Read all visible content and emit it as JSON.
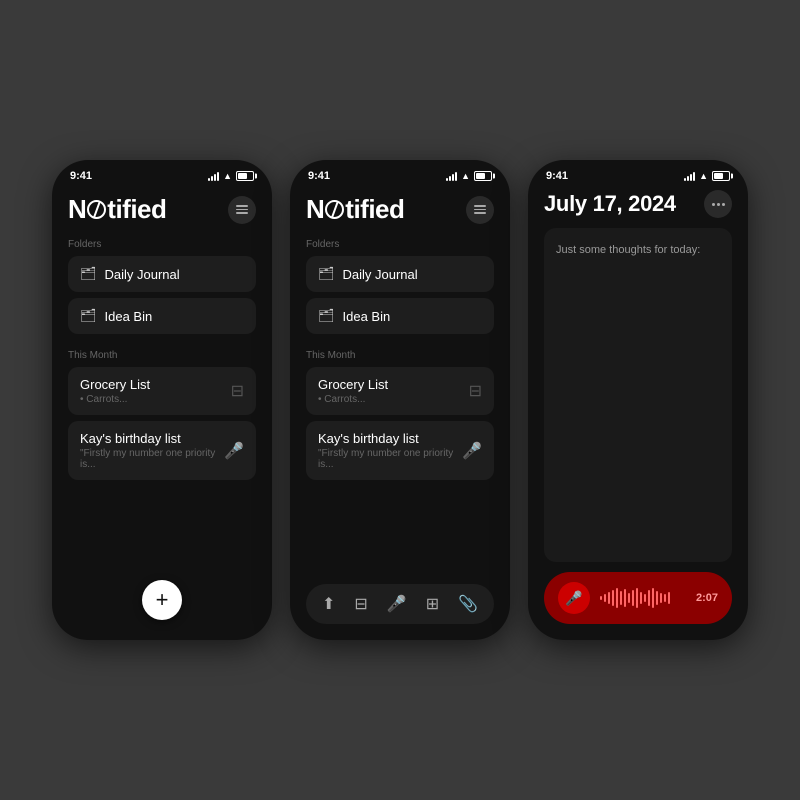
{
  "background": "#3a3a3a",
  "phones": [
    {
      "id": "phone1",
      "statusBar": {
        "time": "9:41"
      },
      "header": {
        "title": "Notified",
        "menuLabel": "menu"
      },
      "folders": {
        "sectionLabel": "Folders",
        "items": [
          {
            "name": "Daily Journal"
          },
          {
            "name": "Idea Bin"
          }
        ]
      },
      "thisMonth": {
        "sectionLabel": "This Month",
        "items": [
          {
            "title": "Grocery List",
            "preview": "• Carrots...",
            "iconType": "note"
          },
          {
            "title": "Kay's birthday list",
            "preview": "\"Firstly my number one priority is...",
            "iconType": "mic"
          }
        ]
      },
      "fab": "+",
      "hasToolbar": false
    },
    {
      "id": "phone2",
      "statusBar": {
        "time": "9:41"
      },
      "header": {
        "title": "Notified",
        "menuLabel": "menu"
      },
      "folders": {
        "sectionLabel": "Folders",
        "items": [
          {
            "name": "Daily Journal"
          },
          {
            "name": "Idea Bin"
          }
        ]
      },
      "thisMonth": {
        "sectionLabel": "This Month",
        "items": [
          {
            "title": "Grocery List",
            "preview": "• Carrots...",
            "iconType": "note"
          },
          {
            "title": "Kay's birthday list",
            "preview": "\"Firstly my number one priority is...",
            "iconType": "mic"
          }
        ]
      },
      "hasToolbar": true,
      "toolbar": {
        "icons": [
          "share",
          "note",
          "mic",
          "scan",
          "attach"
        ]
      }
    },
    {
      "id": "phone3",
      "statusBar": {
        "time": "9:41"
      },
      "header": {
        "title": "July 17, 2024",
        "dotsLabel": "more options"
      },
      "noteContent": "Just some thoughts for today:",
      "voiceBar": {
        "time": "2:07",
        "waveBarCount": 18
      }
    }
  ]
}
